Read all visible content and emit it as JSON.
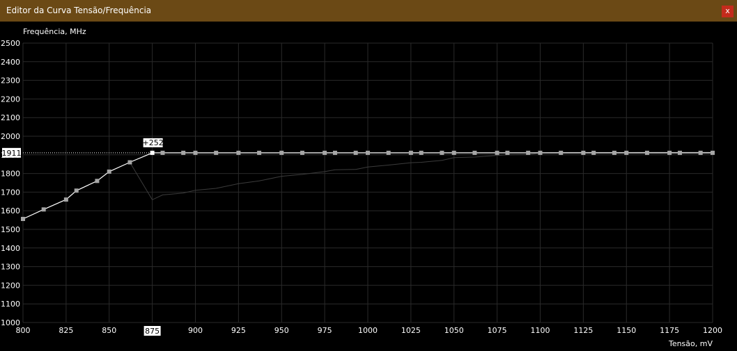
{
  "window": {
    "title": "Editor da Curva Tensão/Frequência",
    "close_label": "x"
  },
  "chart_data": {
    "type": "line",
    "ylabel": "Frequência, MHz",
    "xlabel": "Tensão, mV",
    "xlim": [
      800,
      1200
    ],
    "ylim": [
      1000,
      2500
    ],
    "x_ticks": [
      800,
      825,
      850,
      875,
      900,
      925,
      950,
      975,
      1000,
      1025,
      1050,
      1075,
      1100,
      1125,
      1150,
      1175,
      1200
    ],
    "y_ticks": [
      1000,
      1100,
      1200,
      1300,
      1400,
      1500,
      1600,
      1700,
      1800,
      1900,
      2000,
      2100,
      2200,
      2300,
      2400,
      2500
    ],
    "grid": true,
    "selected_x": 875,
    "selected_x_label": "875",
    "selected_y": 1911,
    "selected_y_label": "1911",
    "offset_label": "+252",
    "series": [
      {
        "role": "edited",
        "x": [
          800,
          812,
          825,
          831,
          843,
          850,
          862,
          875,
          881,
          893,
          900,
          912,
          925,
          937,
          950,
          962,
          975,
          981,
          993,
          1000,
          1012,
          1025,
          1031,
          1043,
          1050,
          1062,
          1075,
          1081,
          1093,
          1100,
          1112,
          1125,
          1131,
          1143,
          1150,
          1162,
          1175,
          1181,
          1193,
          1200
        ],
        "y": [
          1556,
          1607,
          1660,
          1708,
          1760,
          1810,
          1860,
          1911,
          1911,
          1911,
          1911,
          1911,
          1911,
          1911,
          1911,
          1911,
          1911,
          1911,
          1911,
          1911,
          1911,
          1911,
          1911,
          1911,
          1911,
          1911,
          1911,
          1911,
          1911,
          1911,
          1911,
          1911,
          1911,
          1911,
          1911,
          1911,
          1911,
          1911,
          1911,
          1911
        ]
      },
      {
        "role": "default",
        "x": [
          800,
          812,
          825,
          831,
          843,
          850,
          862,
          875,
          881,
          893,
          900,
          912,
          925,
          937,
          950,
          962,
          975,
          981,
          993,
          1000,
          1012,
          1025,
          1031,
          1043,
          1050,
          1062,
          1075,
          1081,
          1093,
          1100,
          1112,
          1125,
          1131,
          1143,
          1150,
          1162,
          1175,
          1181,
          1193,
          1200
        ],
        "y": [
          1556,
          1607,
          1660,
          1708,
          1760,
          1810,
          1860,
          1659,
          1685,
          1695,
          1710,
          1720,
          1745,
          1760,
          1785,
          1795,
          1810,
          1820,
          1822,
          1835,
          1845,
          1858,
          1860,
          1870,
          1885,
          1888,
          1897,
          1900,
          1902,
          1911,
          1913,
          1913,
          1913,
          1913,
          1913,
          1914,
          1914,
          1914,
          1914,
          1914
        ]
      }
    ],
    "colors": {
      "edited_line": "#ffffff",
      "default_line": "#3c3c3c",
      "grid": "#2a2a2a",
      "marker": "#a6a6a6",
      "selected_marker": "#ffffff"
    }
  }
}
